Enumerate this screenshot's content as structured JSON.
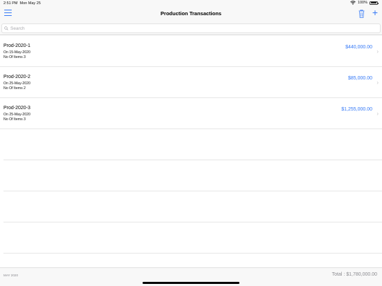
{
  "status_bar": {
    "time": "2:51 PM",
    "date": "Mon May 25",
    "battery": "100%"
  },
  "nav": {
    "title": "Production Transactions"
  },
  "search": {
    "placeholder": "Search"
  },
  "transactions": [
    {
      "name": "Prod-2020-1",
      "date": "On 15-May-2020",
      "items": "No Of Items 3",
      "amount": "$440,000.00"
    },
    {
      "name": "Prod-2020-2",
      "date": "On 25-May-2020",
      "items": "No Of Items 2",
      "amount": "$85,000.00"
    },
    {
      "name": "Prod-2020-3",
      "date": "On 25-May-2020",
      "items": "No Of Items 3",
      "amount": "$1,255,000.00"
    }
  ],
  "footer": {
    "month": "MAY 2020",
    "total": "Total : $1,780,000.00"
  },
  "colors": {
    "accent": "#3478f6",
    "background": "#f8f8f8"
  }
}
